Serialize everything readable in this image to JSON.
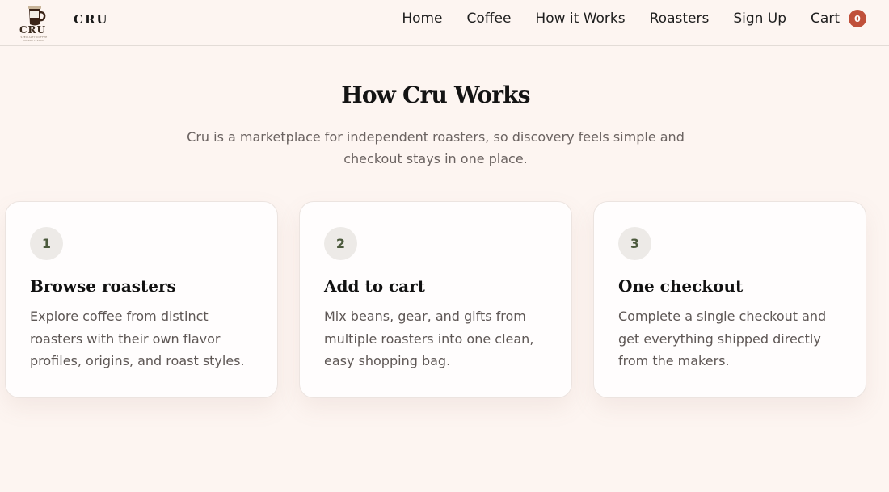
{
  "header": {
    "logo_text": "CRU",
    "logo_tagline": "SPECIALTY COFFEE MARKETPLACE",
    "brand": "CRU",
    "nav": [
      "Home",
      "Coffee",
      "How it Works",
      "Roasters",
      "Sign Up"
    ],
    "cart_label": "Cart",
    "cart_count": "0",
    "icon": "coffee-cup-icon"
  },
  "main": {
    "title": "How Cru Works",
    "subtitle": "Cru is a marketplace for independent roasters, so discovery feels simple and checkout stays in one place."
  },
  "steps": [
    {
      "number": "1",
      "title": "Browse roasters",
      "description": "Explore coffee from distinct roasters with their own flavor profiles, origins, and roast styles."
    },
    {
      "number": "2",
      "title": "Add to cart",
      "description": "Mix beans, gear, and gifts from multiple roasters into one clean, easy shopping bag."
    },
    {
      "number": "3",
      "title": "One checkout",
      "description": "Complete a single checkout and get everything shipped directly from the makers."
    }
  ],
  "colors": {
    "background": "#fdf5f1",
    "accent": "#c0503a",
    "number_text": "#4c5a3d"
  }
}
